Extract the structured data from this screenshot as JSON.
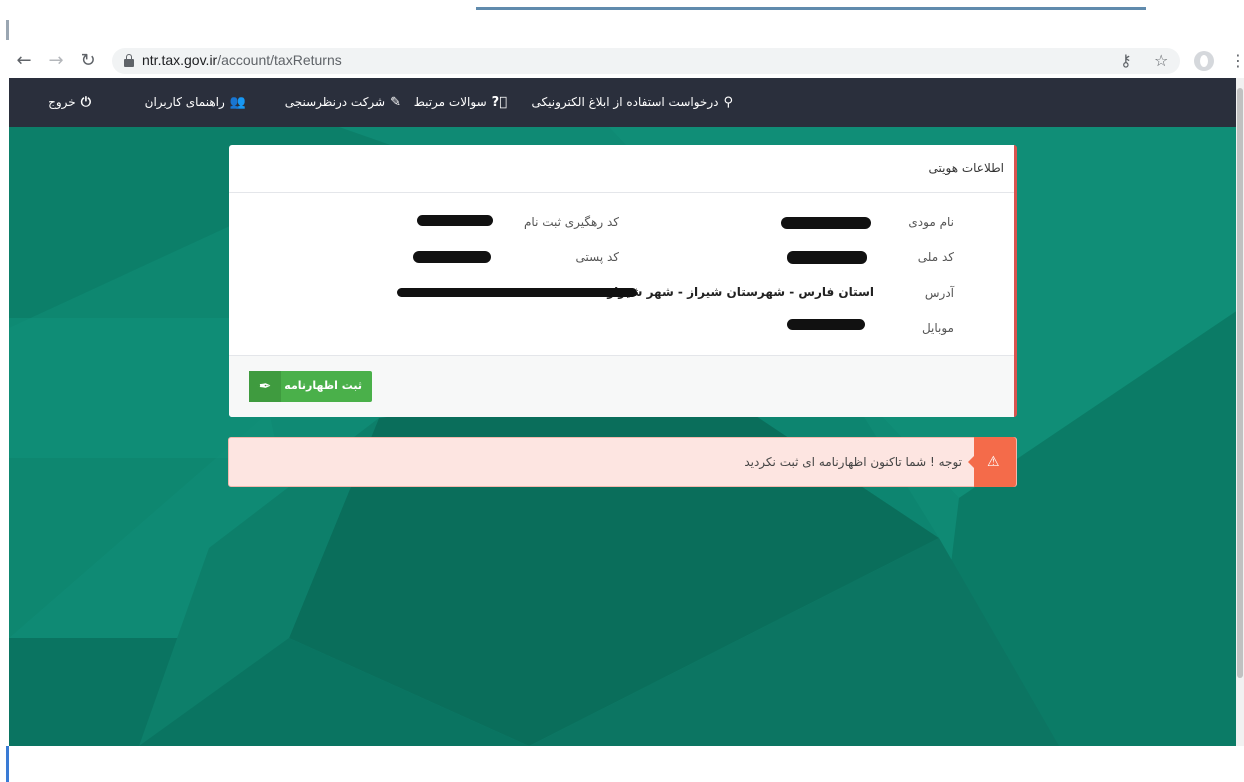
{
  "browser": {
    "url_host": "ntr.tax.gov.ir",
    "url_path": "/account/taxReturns",
    "icons": [
      "back-arrow-icon",
      "forward-arrow-icon",
      "reload-icon",
      "lock-icon",
      "key-icon",
      "star-icon",
      "profile-icon",
      "menu-dots-icon"
    ]
  },
  "navbar": {
    "electronic_notice": "درخواست استفاده از ابلاغ الکترونیکی",
    "faq": "سوالات مرتبط",
    "survey": "شرکت درنظرسنجی",
    "user_guide": "راهنمای کاربران",
    "logout": "خروج"
  },
  "panel": {
    "title": "اطلاعات هویتی",
    "labels": {
      "taxpayer_name": "نام مودی",
      "tracking_code": "کد رهگیری ثبت نام",
      "national_code": "کد ملی",
      "postal_code": "کد پستی",
      "address": "آدرس",
      "mobile": "موبایل"
    },
    "address_value": "استان فارس - شهرستان شیراز - شهر شیراز",
    "register_button": "ثبت اظهارنامه"
  },
  "alert": {
    "message": "توجه ! شما تاکنون اظهارنامه ای ثبت نکردید"
  },
  "colors": {
    "navbar": "#2a2f3c",
    "background": "#0f8a74",
    "button": "#4ab04a",
    "alert_bg": "#fde5e1",
    "alert_icon": "#f46b4a",
    "panel_accent": "#d9534f"
  }
}
